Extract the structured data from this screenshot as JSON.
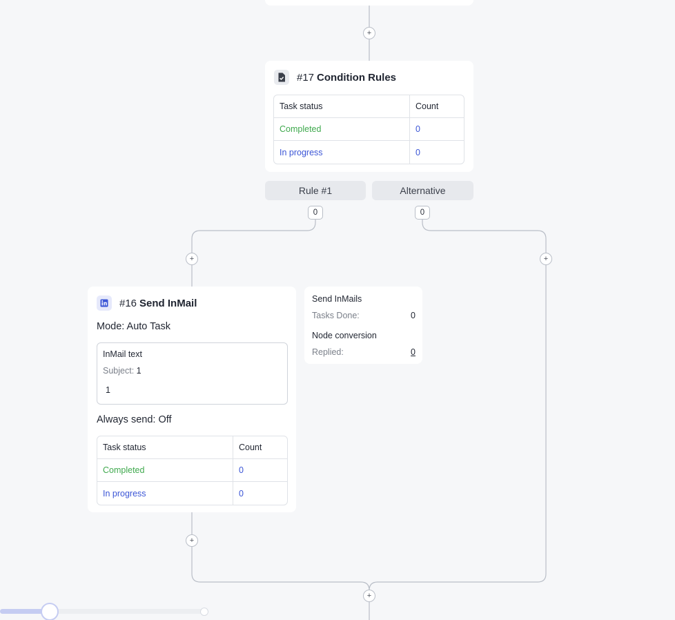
{
  "condition_node": {
    "number": "#17",
    "name": "Condition Rules",
    "table": {
      "header": [
        "Task status",
        "Count"
      ],
      "rows": [
        {
          "status": "Completed",
          "count": "0"
        },
        {
          "status": "In progress",
          "count": "0"
        }
      ]
    }
  },
  "branches": {
    "rule_label": "Rule #1",
    "rule_count": "0",
    "alternative_label": "Alternative",
    "alternative_count": "0"
  },
  "inmail_node": {
    "number": "#16",
    "name": "Send InMail",
    "mode_label": "Mode: ",
    "mode_value": "Auto Task",
    "inmail_box": {
      "title": "InMail text",
      "subject_label": "Subject: ",
      "subject_value": "1",
      "body": "1"
    },
    "always_send_label": "Always send: ",
    "always_send_value": "Off",
    "table": {
      "header": [
        "Task status",
        "Count"
      ],
      "rows": [
        {
          "status": "Completed",
          "count": "0"
        },
        {
          "status": "In progress",
          "count": "0"
        }
      ]
    }
  },
  "stats_panel": {
    "section1_title": "Send InMails",
    "tasks_done_label": "Tasks Done:",
    "tasks_done_value": "0",
    "section2_title": "Node conversion",
    "replied_label": "Replied:",
    "replied_value": "0"
  },
  "add_symbol": "+",
  "zoom_slider": {
    "value": 0.22
  },
  "colors": {
    "completed": "#3fa94d",
    "in_progress": "#3b55d6",
    "wire": "#b9bec7",
    "accent": "#c5ccf2"
  }
}
